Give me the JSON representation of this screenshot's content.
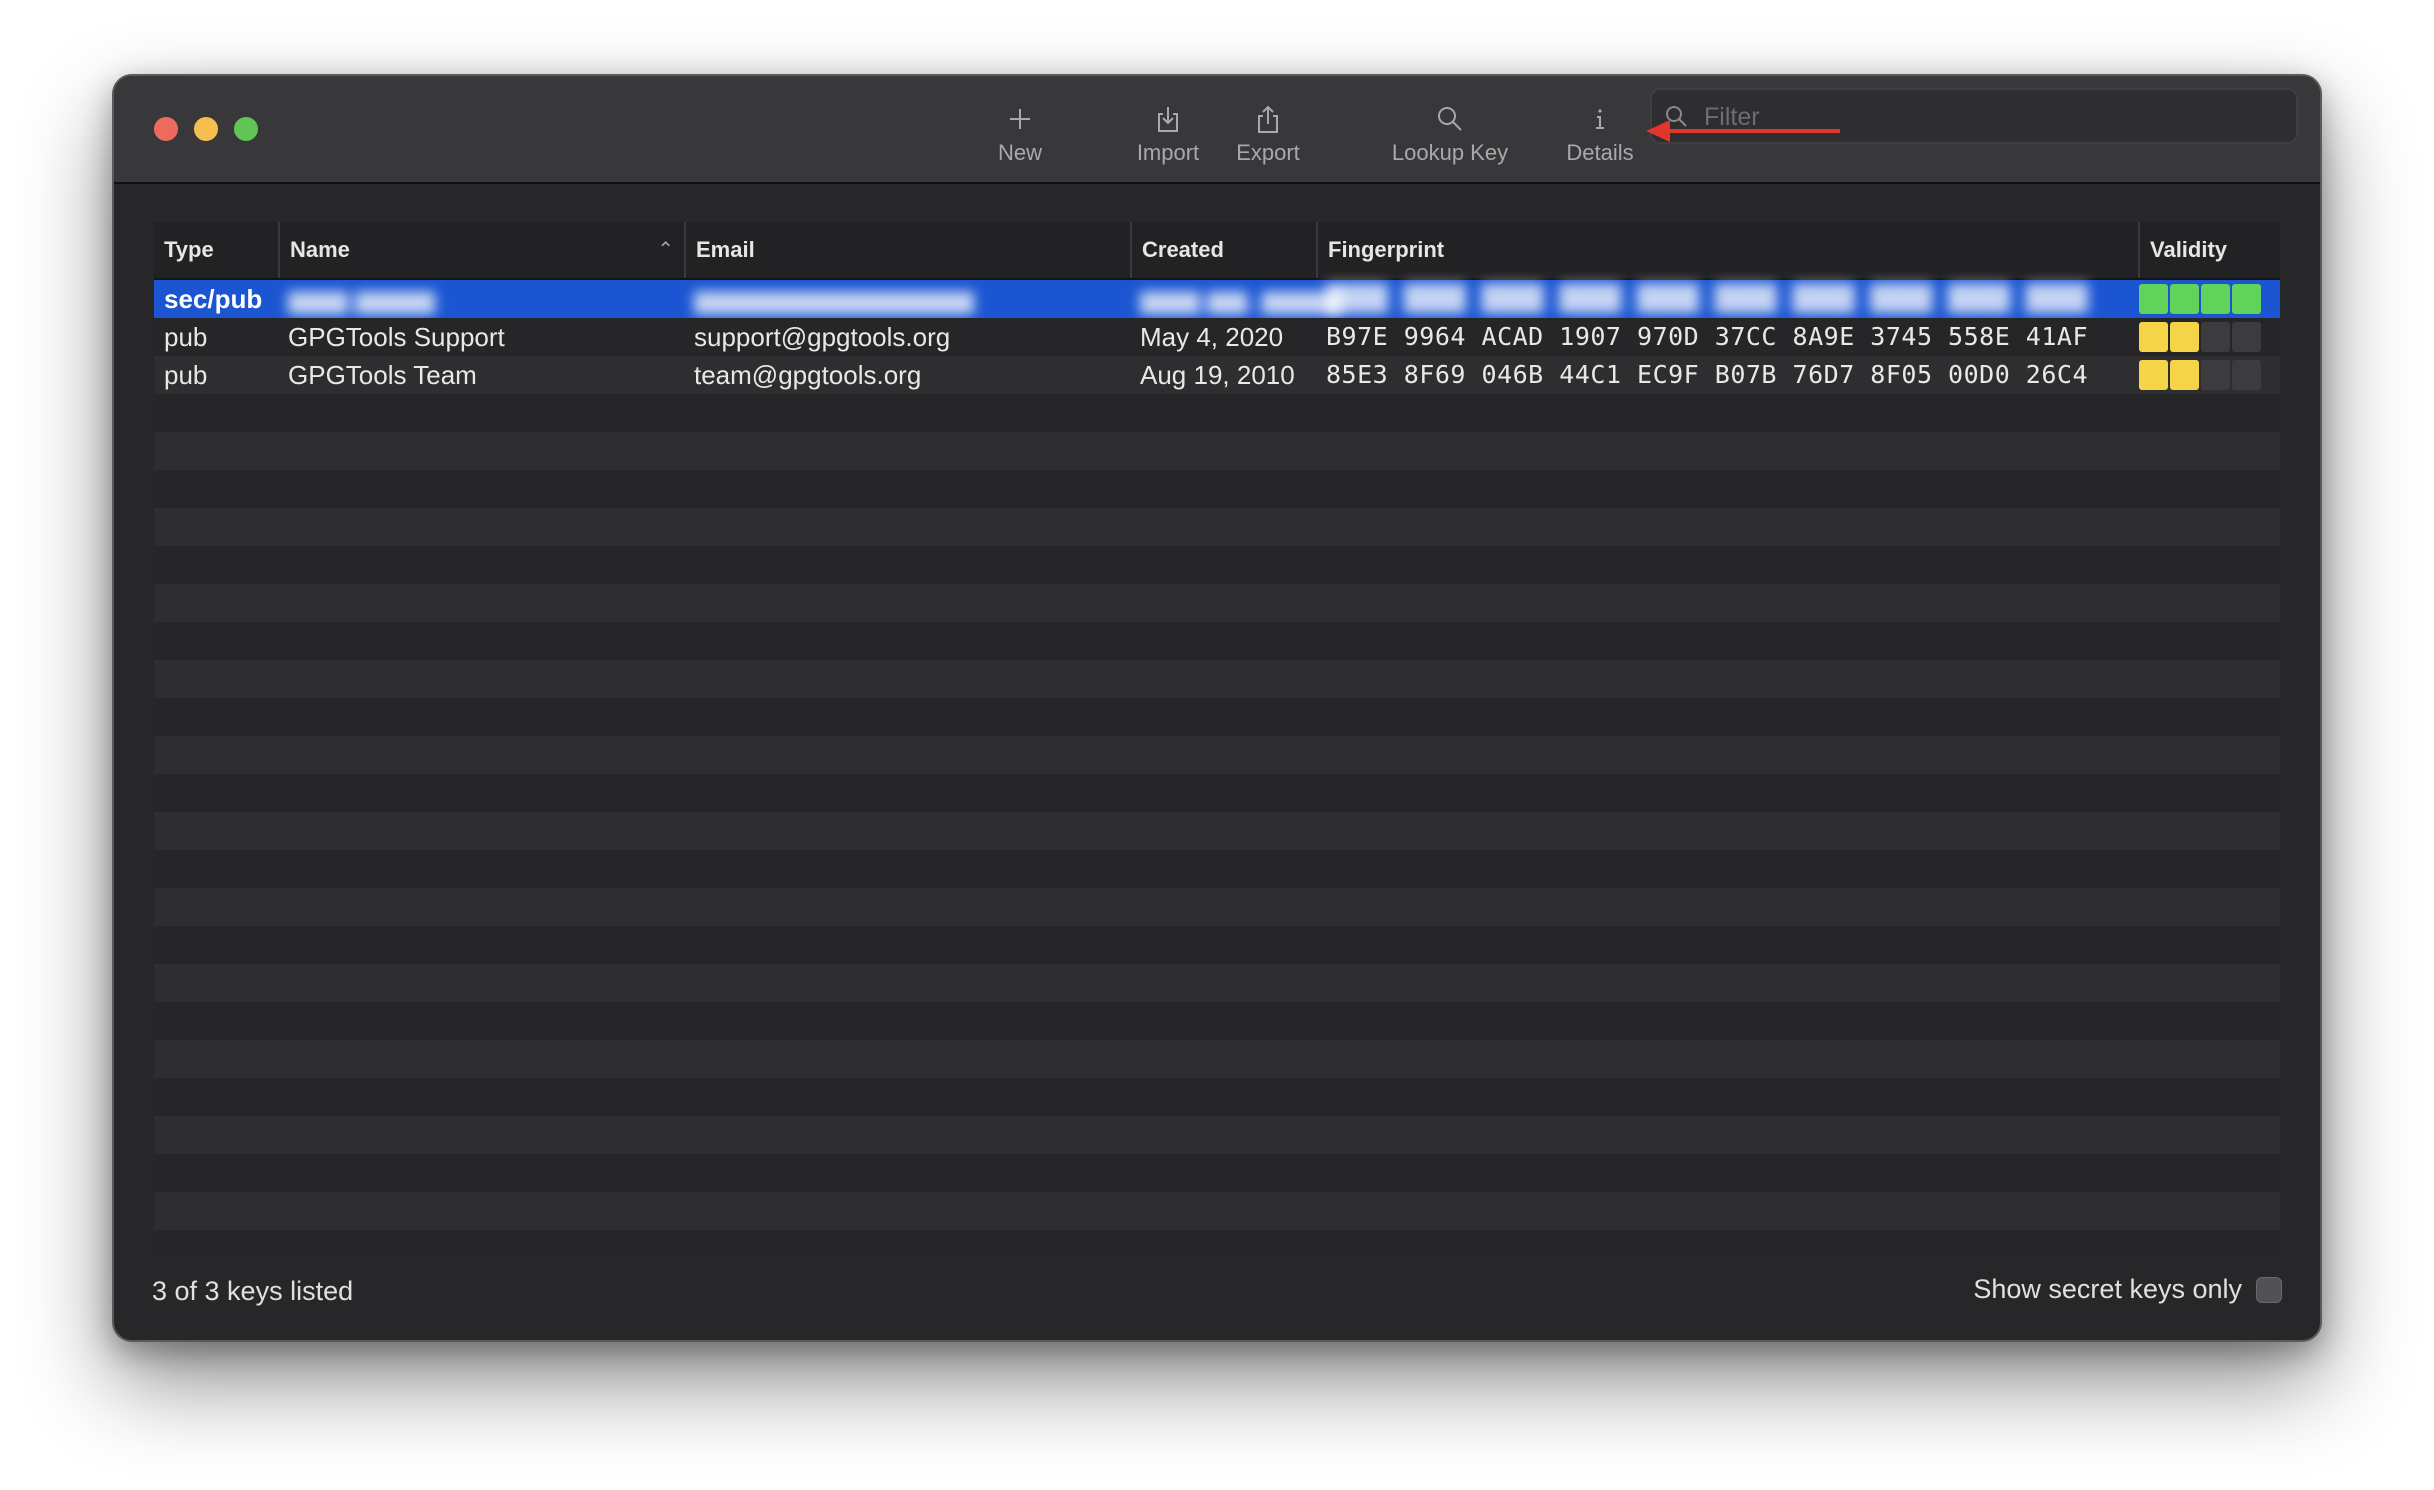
{
  "toolbar": {
    "new_label": "New",
    "import_label": "Import",
    "export_label": "Export",
    "lookup_label": "Lookup Key",
    "details_label": "Details",
    "filter_placeholder": "Filter",
    "filter_value": ""
  },
  "columns": {
    "type": "Type",
    "name": "Name",
    "email": "Email",
    "created": "Created",
    "fingerprint": "Fingerprint",
    "validity": "Validity"
  },
  "sort": {
    "column": "Name",
    "direction": "ascending"
  },
  "keys": [
    {
      "type": "sec/pub",
      "name": "▆▆▆ ▆▆▆▆",
      "email": "▆▆▆▆▆▆▆▆▆▆▆▆▆▆",
      "created": "▆▆▆ ▆▆, ▆▆▆▆",
      "fingerprint": "████ ████ ████ ████ ████  ████ ████ ████ ████ ████",
      "validity_level": 4,
      "validity_color": "#5fd35a",
      "selected": true,
      "redacted": true
    },
    {
      "type": "pub",
      "name": "GPGTools Support",
      "email": "support@gpgtools.org",
      "created": "May 4, 2020",
      "fingerprint": "B97E 9964 ACAD 1907 970D  37CC 8A9E 3745 558E 41AF",
      "validity_level": 2,
      "validity_color": "#f5d547",
      "selected": false,
      "redacted": false
    },
    {
      "type": "pub",
      "name": "GPGTools Team",
      "email": "team@gpgtools.org",
      "created": "Aug 19, 2010",
      "fingerprint": "85E3 8F69 046B 44C1 EC9F  B07B 76D7 8F05 00D0 26C4",
      "validity_level": 2,
      "validity_color": "#f5d547",
      "selected": false,
      "redacted": false
    }
  ],
  "footer": {
    "status": "3 of 3 keys listed",
    "secret_only_label": "Show secret keys only",
    "secret_only_checked": false
  },
  "colors": {
    "selection": "#1b55d1",
    "validity_empty": "#3c3c3f",
    "annotation_arrow": "#e0362b"
  }
}
